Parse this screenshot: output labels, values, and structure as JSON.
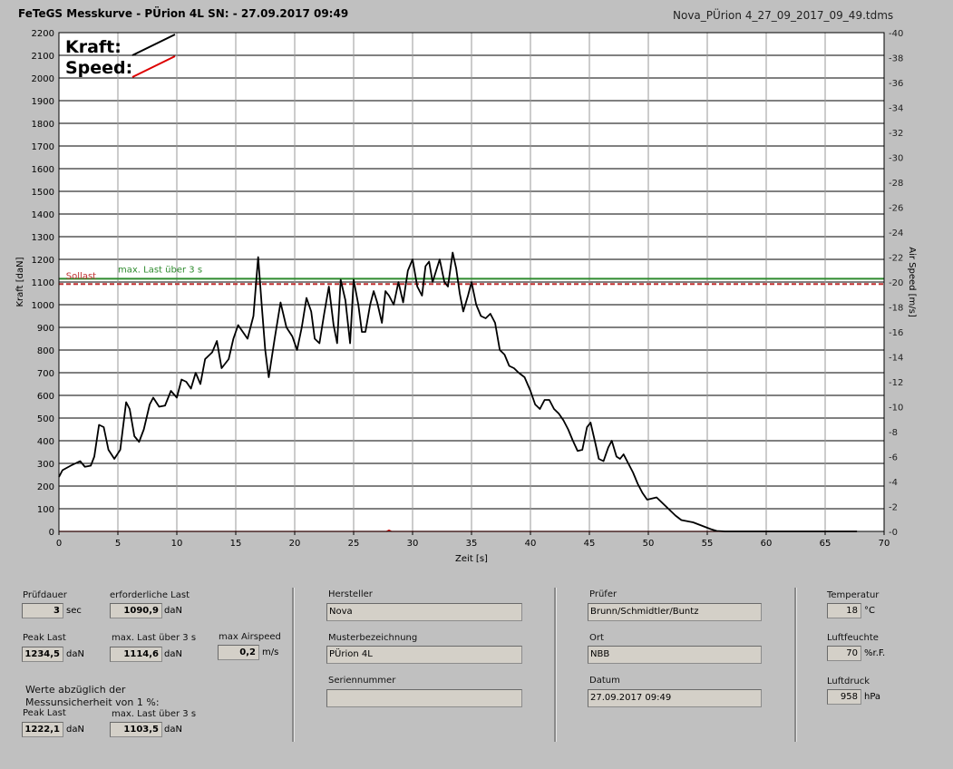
{
  "header": {
    "title": "FeTeGS Messkurve - PÜrion 4L  SN:  - 27.09.2017 09:49",
    "filename": "Nova_PÜrion 4_27_09_2017_09_49.tdms"
  },
  "chart_data": {
    "type": "line",
    "xlabel": "Zeit [s]",
    "ylabel": "Kraft [daN]",
    "y2label": "Air Speed [m/s]",
    "xlim": [
      0,
      70
    ],
    "ylim": [
      0,
      2200
    ],
    "y2lim": [
      0,
      40
    ],
    "xticks": [
      0,
      5,
      10,
      15,
      20,
      25,
      30,
      35,
      40,
      45,
      50,
      55,
      60,
      65,
      70
    ],
    "yticks": [
      0,
      100,
      200,
      300,
      400,
      500,
      600,
      700,
      800,
      900,
      1000,
      1100,
      1200,
      1300,
      1400,
      1500,
      1600,
      1700,
      1800,
      1900,
      2000,
      2100,
      2200
    ],
    "y2ticks": [
      0,
      2,
      4,
      6,
      8,
      10,
      12,
      14,
      16,
      18,
      20,
      22,
      24,
      26,
      28,
      30,
      32,
      34,
      36,
      38,
      40
    ],
    "grid": true,
    "legend": [
      {
        "name": "Kraft:",
        "color": "#000000"
      },
      {
        "name": "Speed:",
        "color": "#dd0000"
      }
    ],
    "reference_lines": [
      {
        "label": "max. Last über  3 s",
        "y": 1114.6,
        "color": "#2e8b2e"
      },
      {
        "label": "Sollast",
        "y": 1090.9,
        "color": "#c03030"
      }
    ],
    "series": [
      {
        "name": "Kraft",
        "color": "#000000",
        "points": [
          [
            0,
            240
          ],
          [
            0.3,
            270
          ],
          [
            1,
            290
          ],
          [
            1.8,
            310
          ],
          [
            2.2,
            285
          ],
          [
            2.7,
            290
          ],
          [
            3,
            330
          ],
          [
            3.4,
            470
          ],
          [
            3.8,
            460
          ],
          [
            4.2,
            360
          ],
          [
            4.7,
            320
          ],
          [
            5.2,
            360
          ],
          [
            5.7,
            570
          ],
          [
            6,
            540
          ],
          [
            6.4,
            420
          ],
          [
            6.8,
            395
          ],
          [
            7.2,
            450
          ],
          [
            7.7,
            560
          ],
          [
            8,
            590
          ],
          [
            8.5,
            550
          ],
          [
            9,
            555
          ],
          [
            9.5,
            620
          ],
          [
            10,
            590
          ],
          [
            10.4,
            670
          ],
          [
            10.8,
            660
          ],
          [
            11.2,
            630
          ],
          [
            11.6,
            700
          ],
          [
            12,
            650
          ],
          [
            12.4,
            760
          ],
          [
            13,
            790
          ],
          [
            13.4,
            840
          ],
          [
            13.8,
            720
          ],
          [
            14.4,
            760
          ],
          [
            14.8,
            850
          ],
          [
            15.2,
            910
          ],
          [
            15.6,
            880
          ],
          [
            16,
            850
          ],
          [
            16.5,
            950
          ],
          [
            16.9,
            1210
          ],
          [
            17.2,
            1000
          ],
          [
            17.5,
            800
          ],
          [
            17.8,
            680
          ],
          [
            18.3,
            850
          ],
          [
            18.8,
            1010
          ],
          [
            19.3,
            900
          ],
          [
            19.8,
            860
          ],
          [
            20.2,
            800
          ],
          [
            20.6,
            900
          ],
          [
            21,
            1030
          ],
          [
            21.4,
            970
          ],
          [
            21.7,
            850
          ],
          [
            22.1,
            830
          ],
          [
            22.5,
            960
          ],
          [
            22.9,
            1080
          ],
          [
            23.3,
            910
          ],
          [
            23.6,
            830
          ],
          [
            23.9,
            1110
          ],
          [
            24.3,
            1020
          ],
          [
            24.7,
            830
          ],
          [
            25,
            1110
          ],
          [
            25.4,
            1000
          ],
          [
            25.7,
            880
          ],
          [
            26,
            880
          ],
          [
            26.4,
            1000
          ],
          [
            26.7,
            1060
          ],
          [
            27,
            1010
          ],
          [
            27.4,
            920
          ],
          [
            27.7,
            1060
          ],
          [
            28,
            1040
          ],
          [
            28.4,
            1000
          ],
          [
            28.8,
            1100
          ],
          [
            29.2,
            1010
          ],
          [
            29.6,
            1150
          ],
          [
            30,
            1200
          ],
          [
            30.4,
            1080
          ],
          [
            30.8,
            1040
          ],
          [
            31.1,
            1170
          ],
          [
            31.4,
            1190
          ],
          [
            31.7,
            1100
          ],
          [
            32,
            1150
          ],
          [
            32.3,
            1200
          ],
          [
            32.7,
            1100
          ],
          [
            33,
            1080
          ],
          [
            33.4,
            1230
          ],
          [
            33.7,
            1160
          ],
          [
            34,
            1050
          ],
          [
            34.3,
            970
          ],
          [
            34.7,
            1040
          ],
          [
            35,
            1100
          ],
          [
            35.4,
            1000
          ],
          [
            35.8,
            950
          ],
          [
            36.2,
            940
          ],
          [
            36.6,
            960
          ],
          [
            37,
            920
          ],
          [
            37.4,
            800
          ],
          [
            37.8,
            780
          ],
          [
            38.2,
            730
          ],
          [
            38.6,
            720
          ],
          [
            39,
            700
          ],
          [
            39.5,
            680
          ],
          [
            40,
            620
          ],
          [
            40.4,
            560
          ],
          [
            40.8,
            540
          ],
          [
            41.2,
            580
          ],
          [
            41.6,
            580
          ],
          [
            42,
            540
          ],
          [
            42.4,
            520
          ],
          [
            42.8,
            490
          ],
          [
            43.2,
            450
          ],
          [
            43.6,
            400
          ],
          [
            44,
            355
          ],
          [
            44.4,
            360
          ],
          [
            44.8,
            460
          ],
          [
            45.1,
            480
          ],
          [
            45.5,
            390
          ],
          [
            45.8,
            320
          ],
          [
            46.2,
            310
          ],
          [
            46.6,
            370
          ],
          [
            46.9,
            400
          ],
          [
            47.3,
            330
          ],
          [
            47.6,
            320
          ],
          [
            47.9,
            340
          ],
          [
            48.3,
            300
          ],
          [
            48.7,
            260
          ],
          [
            49.1,
            210
          ],
          [
            49.5,
            170
          ],
          [
            49.9,
            140
          ],
          [
            50.3,
            145
          ],
          [
            50.7,
            150
          ],
          [
            51.1,
            130
          ],
          [
            51.5,
            110
          ],
          [
            51.9,
            90
          ],
          [
            52.3,
            70
          ],
          [
            52.8,
            50
          ],
          [
            53.3,
            45
          ],
          [
            53.8,
            40
          ],
          [
            54.3,
            30
          ],
          [
            54.8,
            20
          ],
          [
            55.3,
            10
          ],
          [
            55.8,
            2
          ],
          [
            56.5,
            0
          ],
          [
            60,
            0
          ],
          [
            65,
            0
          ],
          [
            67.7,
            0
          ]
        ]
      },
      {
        "name": "Speed",
        "color": "#dd0000",
        "points": [
          [
            0,
            0
          ],
          [
            27.8,
            0
          ],
          [
            28,
            0.1
          ],
          [
            28.2,
            0
          ],
          [
            67.7,
            0
          ]
        ]
      }
    ]
  },
  "fields": {
    "pruefdauer": {
      "label": "Prüfdauer",
      "value": "3",
      "unit": "sec"
    },
    "erforderliche_last": {
      "label": "erforderliche Last",
      "value": "1090,9",
      "unit": "daN"
    },
    "peak_last": {
      "label": "Peak Last",
      "value": "1234,5",
      "unit": "daN"
    },
    "max_last": {
      "label": "max. Last über  3 s",
      "value": "1114,6",
      "unit": "daN"
    },
    "max_airspeed": {
      "label": "max Airspeed",
      "value": "0,2",
      "unit": "m/s"
    },
    "note_line1": "Werte abzüglich der",
    "note_line2": "Messunsicherheit von 1  %:",
    "peak_last_corr": {
      "label": "Peak Last",
      "value": "1222,1",
      "unit": "daN"
    },
    "max_last_corr": {
      "label": "max. Last über  3 s",
      "value": "1103,5",
      "unit": "daN"
    },
    "hersteller": {
      "label": "Hersteller",
      "value": "Nova"
    },
    "musterbezeichnung": {
      "label": "Musterbezeichnung",
      "value": "PÜrion 4L"
    },
    "seriennummer": {
      "label": "Seriennummer",
      "value": ""
    },
    "pruefer": {
      "label": "Prüfer",
      "value": "Brunn/Schmidtler/Buntz"
    },
    "ort": {
      "label": "Ort",
      "value": "NBB"
    },
    "datum": {
      "label": "Datum",
      "value": "27.09.2017 09:49"
    },
    "temperatur": {
      "label": "Temperatur",
      "value": "18",
      "unit": "°C"
    },
    "luftfeuchte": {
      "label": "Luftfeuchte",
      "value": "70",
      "unit": "%r.F."
    },
    "luftdruck": {
      "label": "Luftdruck",
      "value": "958",
      "unit": "hPa"
    }
  }
}
